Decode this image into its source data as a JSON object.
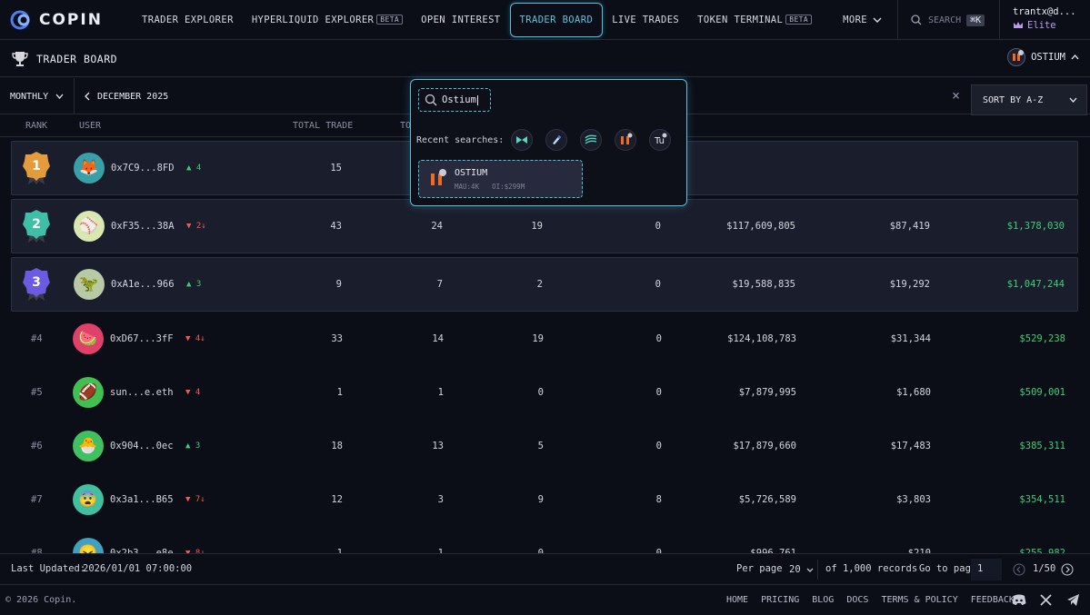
{
  "brand": "COPIN",
  "nav": {
    "items": [
      {
        "label": "TRADER EXPLORER"
      },
      {
        "label": "HYPERLIQUID EXPLORER",
        "badge": "BETA"
      },
      {
        "label": "OPEN INTEREST"
      },
      {
        "label": "TRADER BOARD",
        "active": true
      },
      {
        "label": "LIVE TRADES"
      },
      {
        "label": "TOKEN TERMINAL",
        "badge": "BETA"
      },
      {
        "label": "MORE"
      }
    ],
    "search_label": "SEARCH",
    "search_shortcut": "⌘K",
    "user_name": "trantx@d...",
    "user_tier": "Elite"
  },
  "page": {
    "title": "TRADER BOARD",
    "protocol": "OSTIUM"
  },
  "filters": {
    "period": "MONTHLY",
    "month": "DECEMBER 2025",
    "sort": "SORT BY A-Z"
  },
  "table": {
    "headers": {
      "rank": "RANK",
      "user": "USER",
      "total_trade": "TOTAL TRADE",
      "total_win": "TO"
    },
    "rows": [
      {
        "rank": "1",
        "avatar": "🦊",
        "address": "0x7C9...8FD",
        "trend": "4",
        "dir": "up",
        "total_trade": "15",
        "win": "",
        "lose": "",
        "liq": "",
        "volume": "",
        "fees": "",
        "pnl": ""
      },
      {
        "rank": "2",
        "avatar": "⚾",
        "address": "0xF35...38A",
        "trend": "2↓",
        "dir": "down",
        "total_trade": "43",
        "win": "24",
        "lose": "19",
        "liq": "0",
        "volume": "$117,609,805",
        "fees": "$87,419",
        "pnl": "$1,378,030"
      },
      {
        "rank": "3",
        "avatar": "🦖",
        "address": "0xA1e...966",
        "trend": "3",
        "dir": "up",
        "total_trade": "9",
        "win": "7",
        "lose": "2",
        "liq": "0",
        "volume": "$19,588,835",
        "fees": "$19,292",
        "pnl": "$1,047,244"
      },
      {
        "rank": "#4",
        "avatar": "🍉",
        "address": "0xD67...3fF",
        "trend": "4↓",
        "dir": "down",
        "total_trade": "33",
        "win": "14",
        "lose": "19",
        "liq": "0",
        "volume": "$124,108,783",
        "fees": "$31,344",
        "pnl": "$529,238"
      },
      {
        "rank": "#5",
        "avatar": "🏈",
        "address": "sun...e.eth",
        "trend": "4",
        "dir": "down",
        "total_trade": "1",
        "win": "1",
        "lose": "0",
        "liq": "0",
        "volume": "$7,879,995",
        "fees": "$1,680",
        "pnl": "$509,001"
      },
      {
        "rank": "#6",
        "avatar": "🐣",
        "address": "0x904...0ec",
        "trend": "3",
        "dir": "up",
        "total_trade": "18",
        "win": "13",
        "lose": "5",
        "liq": "0",
        "volume": "$17,879,660",
        "fees": "$17,483",
        "pnl": "$385,311"
      },
      {
        "rank": "#7",
        "avatar": "😨",
        "address": "0x3a1...B65",
        "trend": "7↓",
        "dir": "down",
        "total_trade": "12",
        "win": "3",
        "lose": "9",
        "liq": "8",
        "volume": "$5,726,589",
        "fees": "$3,803",
        "pnl": "$354,511"
      },
      {
        "rank": "#8",
        "avatar": "😖",
        "address": "0x2b3...e8e",
        "trend": "8↓",
        "dir": "down",
        "total_trade": "1",
        "win": "1",
        "lose": "0",
        "liq": "0",
        "volume": "$996,761",
        "fees": "$210",
        "pnl": "$255,982"
      }
    ]
  },
  "pager": {
    "last_updated_label": "Last Updated:",
    "last_updated": "2026/01/01 07:00:00",
    "per_page_label": "Per page",
    "per_page": "20",
    "records": "of 1,000 records",
    "goto_label": "Go to page",
    "goto_value": "1",
    "page_of": "1/50"
  },
  "footer": {
    "copyright": "© 2026 Copin.",
    "links": [
      "HOME",
      "PRICING",
      "BLOG",
      "DOCS",
      "TERMS & POLICY",
      "FEEDBACK"
    ]
  },
  "search": {
    "query": "Ostium",
    "recent_label": "Recent searches:",
    "result_name": "OSTIUM",
    "result_mau": "MAU:4K",
    "result_oi": "OI:$299M"
  }
}
